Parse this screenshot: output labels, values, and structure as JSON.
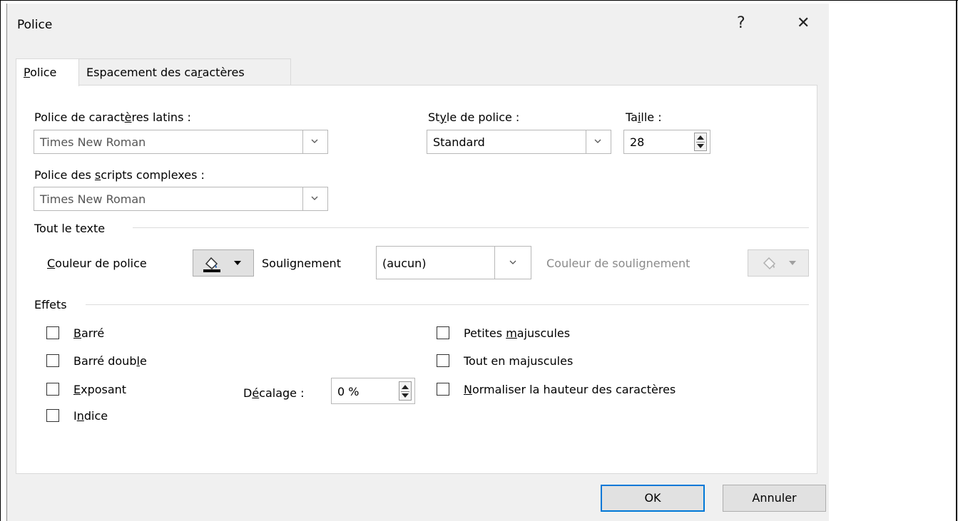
{
  "dialog": {
    "title": "Police",
    "help_label": "?",
    "close_label": "✕"
  },
  "tabs": [
    {
      "pre": "",
      "u": "P",
      "post": "olice",
      "active": true
    },
    {
      "pre": "Espacement des ca",
      "u": "r",
      "post": "actères",
      "active": false
    }
  ],
  "font": {
    "latin": {
      "pre": "Police de caract",
      "u": "è",
      "post": "res latins :",
      "value": "Times New Roman"
    },
    "complex": {
      "pre": "Police des ",
      "u": "s",
      "post": "cripts complexes :",
      "value": "Times New Roman"
    },
    "style": {
      "pre": "St",
      "u": "y",
      "post": "le de police :",
      "value": "Standard"
    },
    "size": {
      "pre": "Ta",
      "u": "i",
      "post": "lle :",
      "value": "28"
    }
  },
  "all_text": {
    "heading": "Tout le texte",
    "font_color": {
      "pre": "",
      "u": "C",
      "post": "ouleur de police"
    },
    "underline": {
      "pre": "Souli",
      "u": "g",
      "post": "nement",
      "value": "(aucun)"
    },
    "underline_color": {
      "pre": "Couleur de souli",
      "u": "g",
      "post": "nement"
    }
  },
  "effects": {
    "heading": "Effets",
    "left": [
      {
        "pre": "",
        "u": "B",
        "post": "arré",
        "checked": false
      },
      {
        "pre": "Barré doub",
        "u": "l",
        "post": "e",
        "checked": false
      },
      {
        "pre": "",
        "u": "E",
        "post": "xposant",
        "checked": false
      },
      {
        "pre": "I",
        "u": "n",
        "post": "dice",
        "checked": false
      }
    ],
    "right": [
      {
        "pre": "Petites ",
        "u": "m",
        "post": "ajuscules",
        "checked": false
      },
      {
        "pre": "Tout en ma",
        "u": "j",
        "post": "uscules",
        "checked": false
      },
      {
        "pre": "",
        "u": "N",
        "post": "ormaliser la hauteur des caractères",
        "checked": false
      }
    ],
    "offset": {
      "pre": "D",
      "u": "é",
      "post": "calage :",
      "value": "0 %"
    }
  },
  "buttons": {
    "ok": "OK",
    "cancel": "Annuler"
  },
  "colors": {
    "accent": "#0078d7",
    "dialog_bg": "#f0f0f0",
    "panel_bg": "#ffffff"
  }
}
